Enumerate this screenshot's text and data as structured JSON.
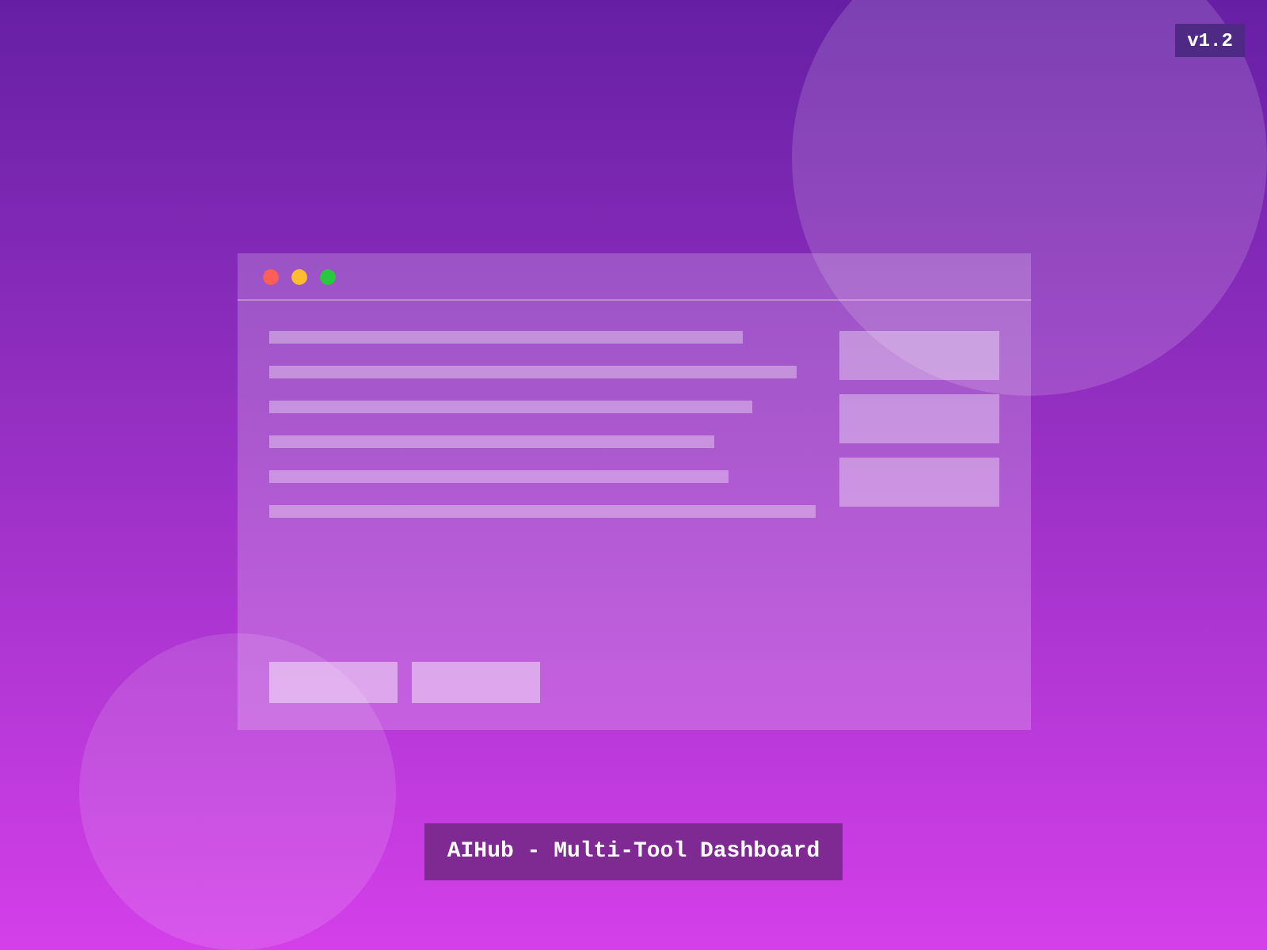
{
  "version_badge": "v1.2",
  "window": {
    "controls": [
      {
        "color": "#ff5f57"
      },
      {
        "color": "#febc2e"
      },
      {
        "color": "#28c840"
      }
    ]
  },
  "caption": "AIHub - Multi-Tool Dashboard"
}
